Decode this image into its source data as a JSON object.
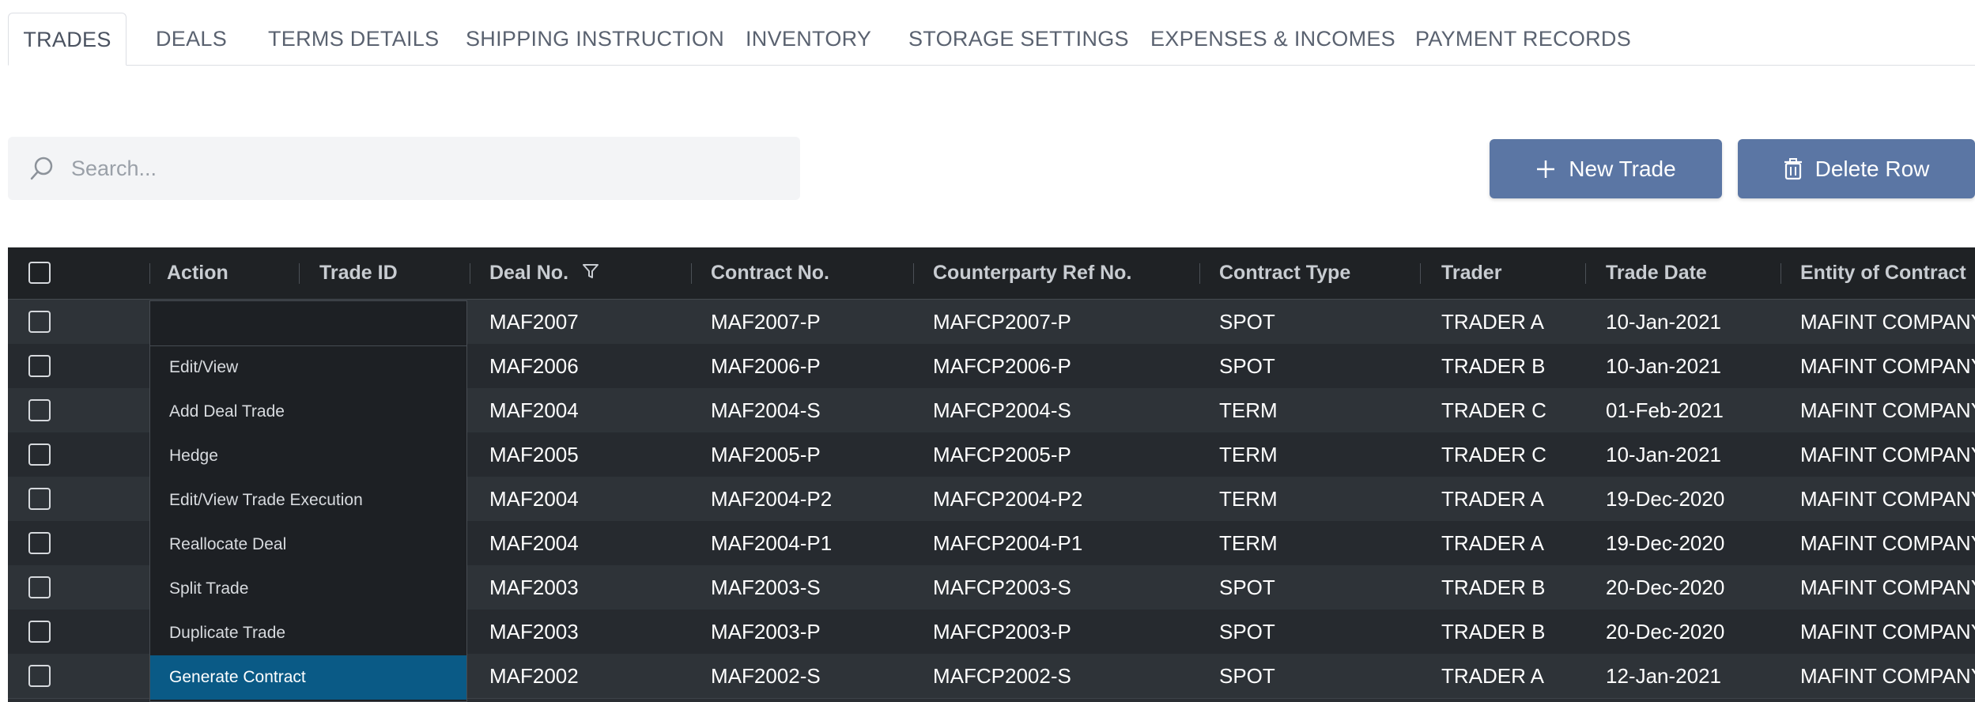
{
  "tabs": [
    {
      "label": "TRADES",
      "active": true
    },
    {
      "label": "DEALS"
    },
    {
      "label": "TERMS DETAILS"
    },
    {
      "label": "SHIPPING INSTRUCTION"
    },
    {
      "label": "INVENTORY"
    },
    {
      "label": "STORAGE SETTINGS"
    },
    {
      "label": "EXPENSES & INCOMES"
    },
    {
      "label": "PAYMENT RECORDS"
    }
  ],
  "search": {
    "placeholder": "Search...",
    "value": ""
  },
  "toolbar": {
    "new_trade_label": "New Trade",
    "delete_row_label": "Delete Row",
    "button_color": "#5b76a4"
  },
  "grid": {
    "columns": [
      "Action",
      "Trade ID",
      "Deal No.",
      "Contract No.",
      "Counterparty Ref No.",
      "Contract Type",
      "Trader",
      "Trade Date",
      "Entity of Contract"
    ],
    "rows": [
      {
        "deal_no": "MAF2007",
        "contract_no": "MAF2007-P",
        "counterparty_ref": "MAFCP2007-P",
        "contract_type": "SPOT",
        "trader": "TRADER A",
        "trade_date": "10-Jan-2021",
        "entity": "MAFINT COMPANY"
      },
      {
        "deal_no": "MAF2006",
        "contract_no": "MAF2006-P",
        "counterparty_ref": "MAFCP2006-P",
        "contract_type": "SPOT",
        "trader": "TRADER B",
        "trade_date": "10-Jan-2021",
        "entity": "MAFINT COMPANY"
      },
      {
        "deal_no": "MAF2004",
        "contract_no": "MAF2004-S",
        "counterparty_ref": "MAFCP2004-S",
        "contract_type": "TERM",
        "trader": "TRADER C",
        "trade_date": "01-Feb-2021",
        "entity": "MAFINT COMPANY"
      },
      {
        "deal_no": "MAF2005",
        "contract_no": "MAF2005-P",
        "counterparty_ref": "MAFCP2005-P",
        "contract_type": "TERM",
        "trader": "TRADER C",
        "trade_date": "10-Jan-2021",
        "entity": "MAFINT COMPANY"
      },
      {
        "deal_no": "MAF2004",
        "contract_no": "MAF2004-P2",
        "counterparty_ref": "MAFCP2004-P2",
        "contract_type": "TERM",
        "trader": "TRADER A",
        "trade_date": "19-Dec-2020",
        "entity": "MAFINT COMPANY"
      },
      {
        "deal_no": "MAF2004",
        "contract_no": "MAF2004-P1",
        "counterparty_ref": "MAFCP2004-P1",
        "contract_type": "TERM",
        "trader": "TRADER A",
        "trade_date": "19-Dec-2020",
        "entity": "MAFINT COMPANY"
      },
      {
        "deal_no": "MAF2003",
        "contract_no": "MAF2003-S",
        "counterparty_ref": "MAFCP2003-S",
        "contract_type": "SPOT",
        "trader": "TRADER B",
        "trade_date": "20-Dec-2020",
        "entity": "MAFINT COMPANY"
      },
      {
        "deal_no": "MAF2003",
        "contract_no": "MAF2003-P",
        "counterparty_ref": "MAFCP2003-P",
        "contract_type": "SPOT",
        "trader": "TRADER B",
        "trade_date": "20-Dec-2020",
        "entity": "MAFINT COMPANY"
      },
      {
        "deal_no": "MAF2002",
        "contract_no": "MAF2002-S",
        "counterparty_ref": "MAFCP2002-S",
        "contract_type": "SPOT",
        "trader": "TRADER A",
        "trade_date": "12-Jan-2021",
        "entity": "MAFINT COMPANY"
      }
    ]
  },
  "action_menu": {
    "items": [
      "Edit/View",
      "Add Deal Trade",
      "Hedge",
      "Edit/View Trade Execution",
      "Reallocate Deal",
      "Split Trade",
      "Duplicate Trade",
      "Generate Contract"
    ],
    "highlighted": "Generate Contract",
    "highlight_color": "#0a5a86"
  }
}
